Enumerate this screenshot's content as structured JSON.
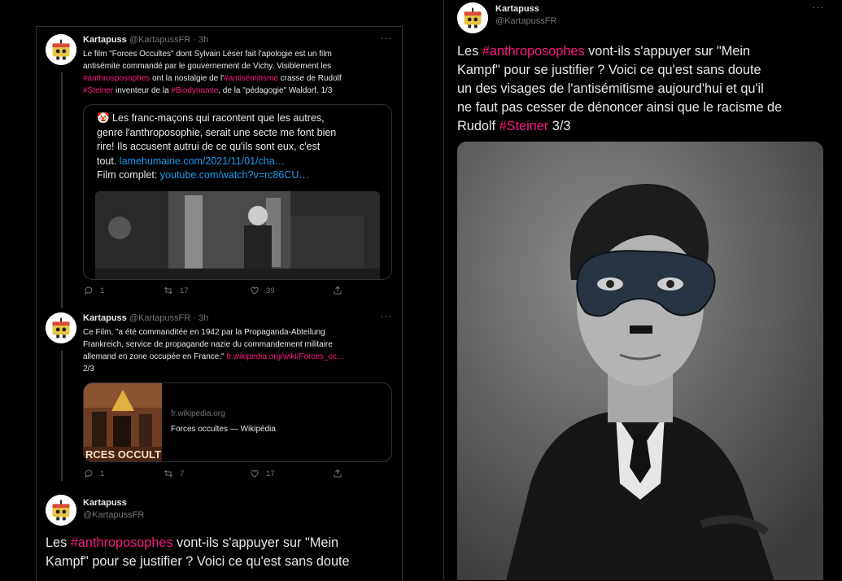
{
  "author": {
    "name": "Kartapuss",
    "handle": "@KartapussFR"
  },
  "tweets": [
    {
      "time": "3h",
      "text_lines": [
        [
          {
            "t": "Le film \"Forces Occultes\" dont Sylvain Léser fait l'apologie est un film"
          }
        ],
        [
          {
            "t": "antisémite commandé par le gouvernement de Vichy. Visiblement les"
          }
        ],
        [
          {
            "t": "#anthrosposophes",
            "c": "tag"
          },
          {
            "t": " ont la nostalgie de l'"
          },
          {
            "t": "#antisémitisme",
            "c": "tag"
          },
          {
            "t": " crasse de Rudolf"
          }
        ],
        [
          {
            "t": "#Steiner",
            "c": "tag"
          },
          {
            "t": " inventeur de la "
          },
          {
            "t": "#Biodynamie",
            "c": "tag"
          },
          {
            "t": ", de la \"pédagogie\" Waldorf. 1/3"
          }
        ]
      ],
      "quote_lines": [
        [
          {
            "t": "🤡 Les franc-maçons qui racontent que les autres,"
          }
        ],
        [
          {
            "t": "genre l'anthroposophie, serait une secte me font bien"
          }
        ],
        [
          {
            "t": "rire! Ils accusent autrui de ce qu'ils sont eux, c'est"
          }
        ],
        [
          {
            "t": "tout. "
          },
          {
            "t": "lamehumaine.com/2021/11/01/cha…",
            "c": "link"
          }
        ],
        [
          {
            "t": "Film complet: "
          },
          {
            "t": "youtube.com/watch?v=rc86CU…",
            "c": "link"
          }
        ]
      ],
      "replies": "1",
      "retweets": "17",
      "likes": "39"
    },
    {
      "time": "3h",
      "text_lines": [
        [
          {
            "t": "Ce Film, \"a été commanditée en 1942 par la Propaganda-Abteilung"
          }
        ],
        [
          {
            "t": "Frankreich, service de propagande nazie du commandement militaire"
          }
        ],
        [
          {
            "t": "allemand en zone occupée en France.\" "
          },
          {
            "t": "fr.wikipedia.org/wiki/Forces_oc…",
            "c": "tag"
          }
        ],
        [
          {
            "t": "2/3"
          }
        ]
      ],
      "link_card": {
        "domain": "fr.wikipedia.org",
        "title": "Forces occultes — Wikipédia",
        "thumb_text": "RCES OCCULT"
      },
      "replies": "1",
      "retweets": "7",
      "likes": "17"
    },
    {
      "text_lines": [
        [
          {
            "t": "Les "
          },
          {
            "t": "#anthroposophes",
            "c": "tag"
          },
          {
            "t": " vont-ils s'appuyer sur  \"Mein"
          }
        ],
        [
          {
            "t": "Kampf\" pour se justifier ? Voici ce qu'est sans doute"
          }
        ]
      ]
    }
  ],
  "main_tweet": {
    "text_lines": [
      [
        {
          "t": "Les "
        },
        {
          "t": "#anthroposophes",
          "c": "tag"
        },
        {
          "t": " vont-ils s'appuyer sur  \"Mein"
        }
      ],
      [
        {
          "t": "Kampf\" pour se justifier ? Voici ce qu'est sans doute"
        }
      ],
      [
        {
          "t": "un des visages de l'antisémitisme aujourd'hui et qu'il"
        }
      ],
      [
        {
          "t": "ne faut pas cesser de dénoncer ainsi que le racisme de"
        }
      ],
      [
        {
          "t": "Rudolf "
        },
        {
          "t": "#Steiner",
          "c": "tag"
        },
        {
          "t": " 3/3"
        }
      ]
    ]
  },
  "more_glyph": "···",
  "icons": [
    "reply-icon",
    "retweet-icon",
    "like-icon",
    "share-icon",
    "more-icon"
  ],
  "colors": {
    "background": "#000000",
    "hashtag": "#f91880",
    "link": "#1d9bf0",
    "muted": "#71767b",
    "divider": "#2f3336"
  }
}
